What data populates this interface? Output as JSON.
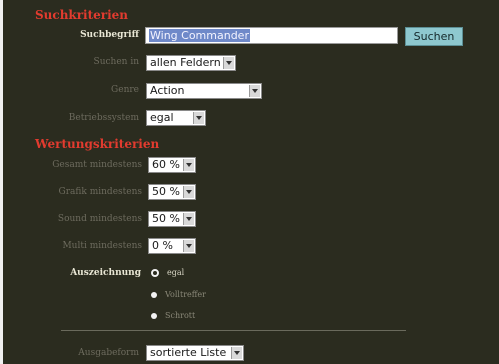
{
  "search_criteria": {
    "title": "Suchkriterien",
    "search_term_label": "Suchbegriff",
    "search_term_value": "Wing Commander",
    "search_button": "Suchen",
    "search_in_label": "Suchen in",
    "search_in_value": "allen Feldern",
    "genre_label": "Genre",
    "genre_value": "Action",
    "system_label": "Betriebssystem",
    "system_value": "egal"
  },
  "rating_criteria": {
    "title": "Wertungskriterien",
    "rows": [
      {
        "label": "Gesamt mindestens",
        "value": "60 %"
      },
      {
        "label": "Grafik mindestens",
        "value": "50 %"
      },
      {
        "label": "Sound mindestens",
        "value": "50 %"
      },
      {
        "label": "Multi mindestens",
        "value": "0 %"
      }
    ],
    "award_label": "Auszeichnung",
    "award_options": [
      {
        "label": "egal",
        "checked": true
      },
      {
        "label": "Volltreffer",
        "checked": false
      },
      {
        "label": "Schrott",
        "checked": false
      }
    ]
  },
  "output": {
    "label": "Ausgabeform",
    "value": "sortierte Liste"
  }
}
